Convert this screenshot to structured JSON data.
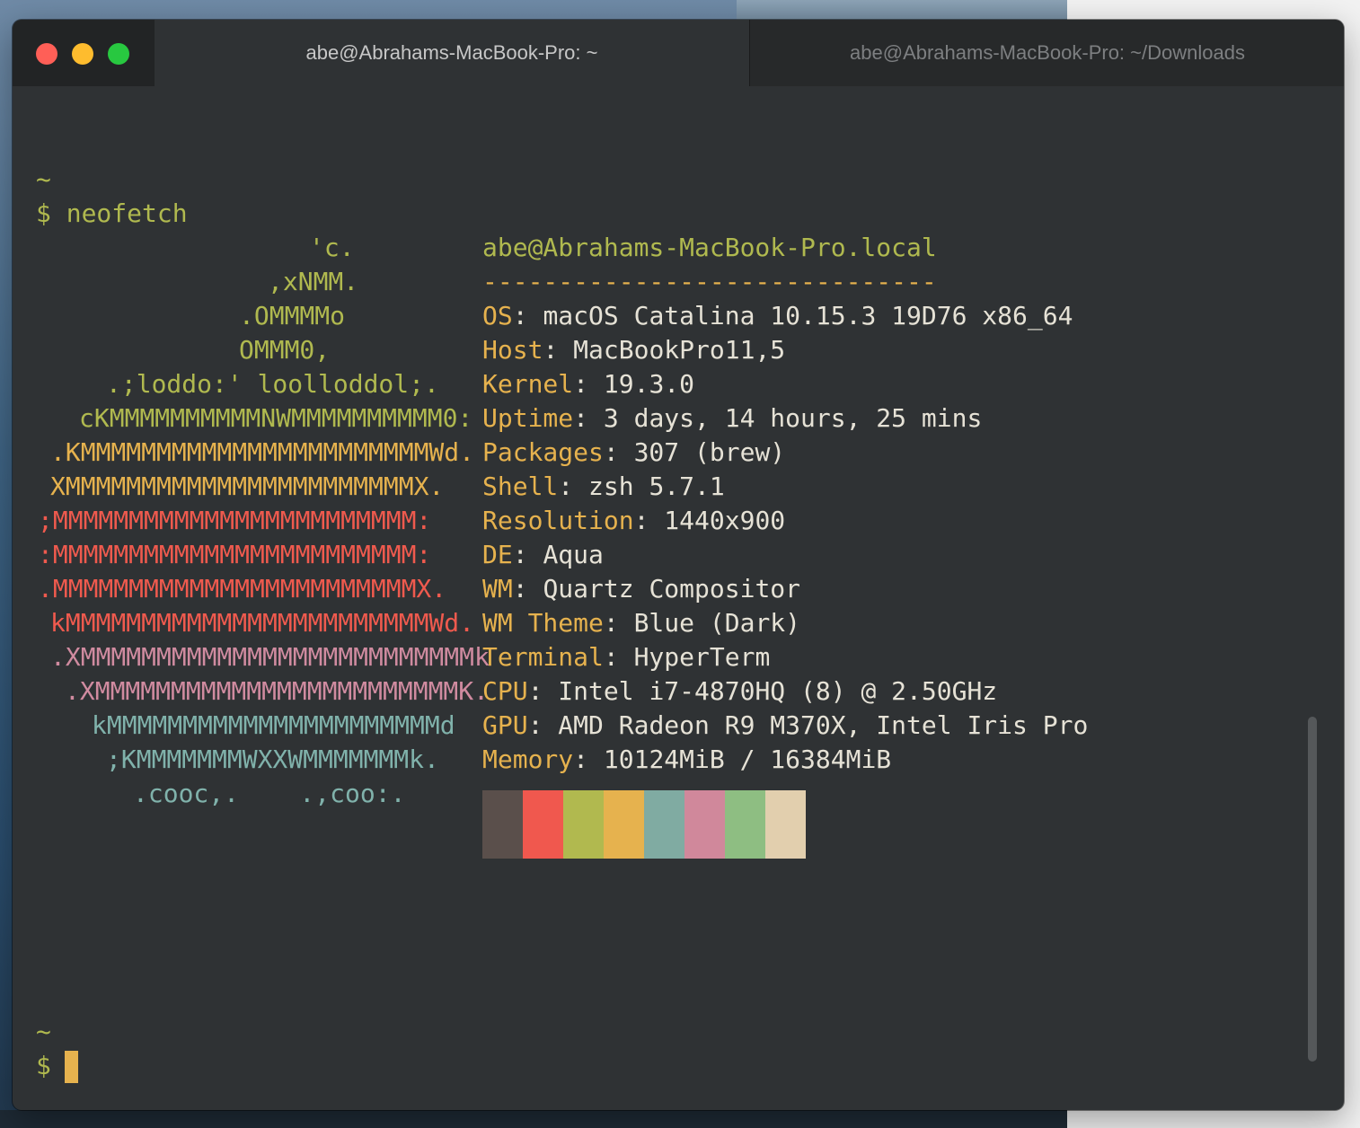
{
  "window": {
    "tabs": [
      {
        "label": "abe@Abrahams-MacBook-Pro: ~",
        "active": true
      },
      {
        "label": "abe@Abrahams-MacBook-Pro: ~/Downloads",
        "active": false
      }
    ],
    "traffic_lights": {
      "close": "#ff5f57",
      "minimize": "#febc2e",
      "zoom": "#28c840"
    }
  },
  "terminal": {
    "prompt_dir": "~",
    "prompt_symbol": "$",
    "command": "neofetch",
    "logo": [
      {
        "text": "'c.",
        "color": "green"
      },
      {
        "text": ",xNMM.",
        "color": "green"
      },
      {
        "text": ".OMMMMo",
        "color": "green"
      },
      {
        "text": "OMMM0,",
        "color": "green"
      },
      {
        "text": ".;loddo:' loolloddol;.",
        "color": "green"
      },
      {
        "text": "cKMMMMMMMMMMNWMMMMMMMMMM0:",
        "color": "green"
      },
      {
        "text": ".KMMMMMMMMMMMMMMMMMMMMMMMWd.",
        "color": "yellow"
      },
      {
        "text": "XMMMMMMMMMMMMMMMMMMMMMMMX.",
        "color": "yellow"
      },
      {
        "text": ";MMMMMMMMMMMMMMMMMMMMMMMM:",
        "color": "red"
      },
      {
        "text": ":MMMMMMMMMMMMMMMMMMMMMMMM:",
        "color": "red"
      },
      {
        "text": ".MMMMMMMMMMMMMMMMMMMMMMMMX.",
        "color": "red"
      },
      {
        "text": "kMMMMMMMMMMMMMMMMMMMMMMMMWd.",
        "color": "red"
      },
      {
        "text": ".XMMMMMMMMMMMMMMMMMMMMMMMMMMk",
        "color": "magenta"
      },
      {
        "text": ".XMMMMMMMMMMMMMMMMMMMMMMMMK.",
        "color": "magenta"
      },
      {
        "text": "kMMMMMMMMMMMMMMMMMMMMMMd",
        "color": "cyan"
      },
      {
        "text": ";KMMMMMMMWXXWMMMMMMMk.",
        "color": "cyan"
      },
      {
        "text": ".cooc,.    .,coo:.",
        "color": "cyan"
      }
    ],
    "user_host": "abe@Abrahams-MacBook-Pro.local",
    "separator": "------------------------------",
    "info": [
      {
        "key": "OS",
        "value": "macOS Catalina 10.15.3 19D76 x86_64"
      },
      {
        "key": "Host",
        "value": "MacBookPro11,5"
      },
      {
        "key": "Kernel",
        "value": "19.3.0"
      },
      {
        "key": "Uptime",
        "value": "3 days, 14 hours, 25 mins"
      },
      {
        "key": "Packages",
        "value": "307 (brew)"
      },
      {
        "key": "Shell",
        "value": "zsh 5.7.1"
      },
      {
        "key": "Resolution",
        "value": "1440x900"
      },
      {
        "key": "DE",
        "value": "Aqua"
      },
      {
        "key": "WM",
        "value": "Quartz Compositor"
      },
      {
        "key": "WM Theme",
        "value": "Blue (Dark)"
      },
      {
        "key": "Terminal",
        "value": "HyperTerm"
      },
      {
        "key": "CPU",
        "value": "Intel i7-4870HQ (8) @ 2.50GHz"
      },
      {
        "key": "GPU",
        "value": "AMD Radeon R9 M370X, Intel Iris Pro"
      },
      {
        "key": "Memory",
        "value": "10124MiB / 16384MiB"
      }
    ],
    "palette": [
      "#5a4f4b",
      "#f0584e",
      "#b1b94f",
      "#e6b24e",
      "#80aba2",
      "#d0889b",
      "#8ebe82",
      "#e2cfae"
    ]
  }
}
